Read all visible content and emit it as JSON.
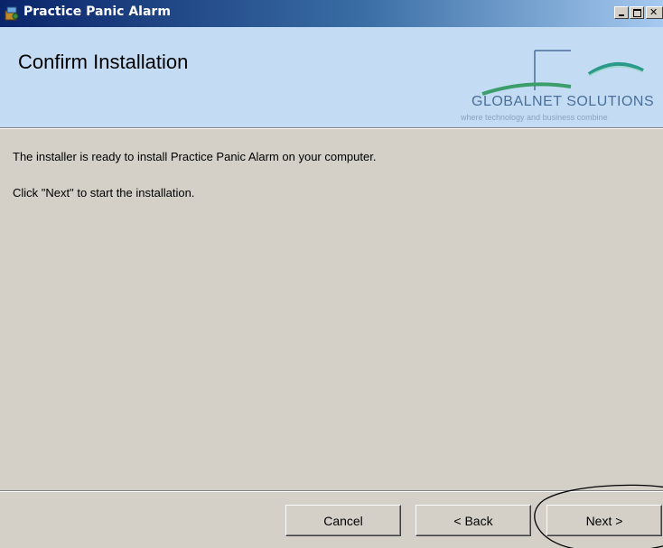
{
  "window": {
    "title": "Practice Panic Alarm"
  },
  "banner": {
    "heading": "Confirm Installation",
    "logo_name": "GLOBALNET SOLUTIONS",
    "logo_tagline": "where technology and business combine",
    "background_color": "#c4dcf3"
  },
  "content": {
    "line1": "The installer is ready to install Practice Panic Alarm on your computer.",
    "line2": "Click \"Next\" to start the installation."
  },
  "buttons": {
    "cancel": "Cancel",
    "back": "< Back",
    "next": "Next >"
  },
  "icons": {
    "app": "installer-icon",
    "minimize": "minimize-icon",
    "maximize": "maximize-icon",
    "close": "close-icon"
  }
}
